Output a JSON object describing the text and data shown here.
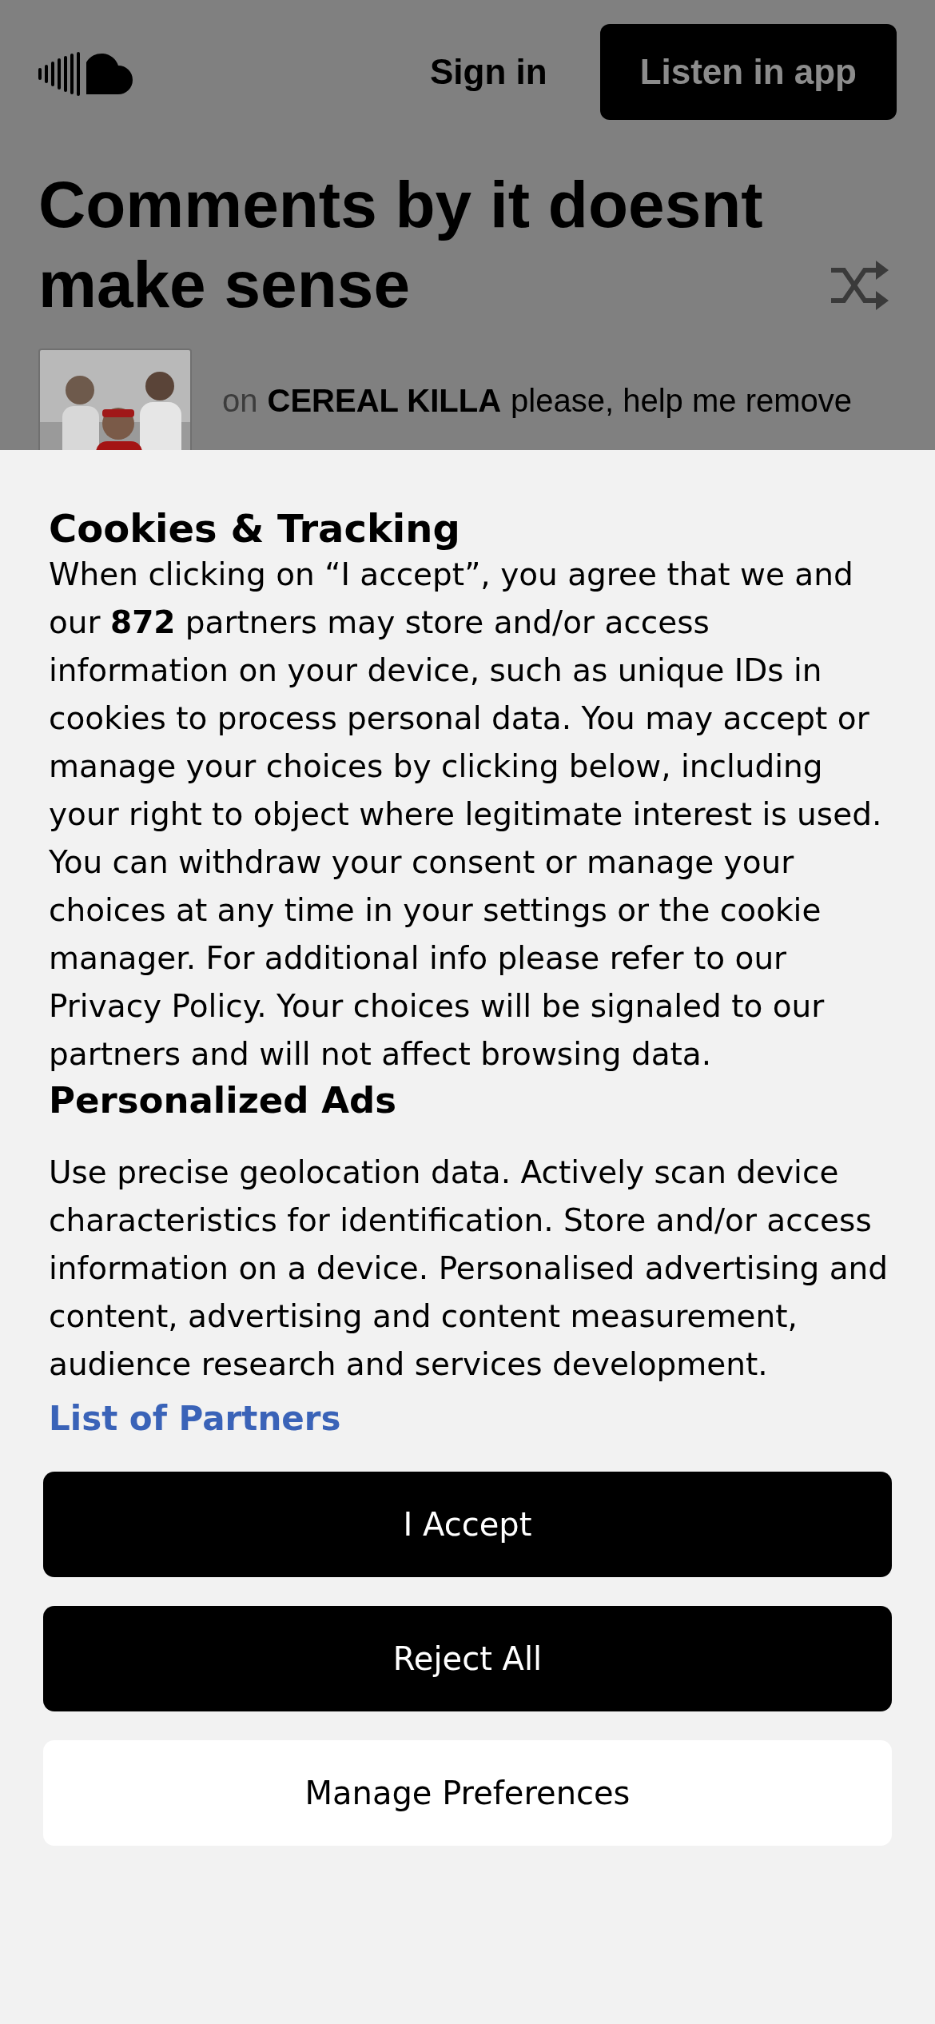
{
  "header": {
    "sign_in": "Sign in",
    "listen_button": "Listen in app"
  },
  "title": "Comments by it doesnt make sense",
  "comment": {
    "prefix": "on",
    "track": "CEREAL KILLA",
    "text": "please, help me remove"
  },
  "consent": {
    "title": "Cookies & Tracking",
    "body": "When clicking on “I accept”, you agree that we and our **872** partners may store and/or access information on your device, such as unique IDs in cookies to process personal data. You may accept or manage your choices by clicking below, including your right to object where legitimate interest is used. You can withdraw your consent or manage your choices at any time in your settings or the cookie manager. For additional info please refer to our Privacy Policy. Your choices will be signaled to our partners and will not affect browsing data.",
    "section_title": "Personalized Ads",
    "purposes": "Use precise geolocation data. Actively scan device characteristics for identification. Store and/or access information on a device. Personalised advertising and content, advertising and content measurement, audience research and services development.",
    "partners_link": "List of Partners",
    "buttons": [
      {
        "label": "I Accept",
        "kind": "primary"
      },
      {
        "label": "Reject All",
        "kind": "primary"
      },
      {
        "label": "Manage Preferences",
        "kind": "secondary"
      }
    ]
  }
}
